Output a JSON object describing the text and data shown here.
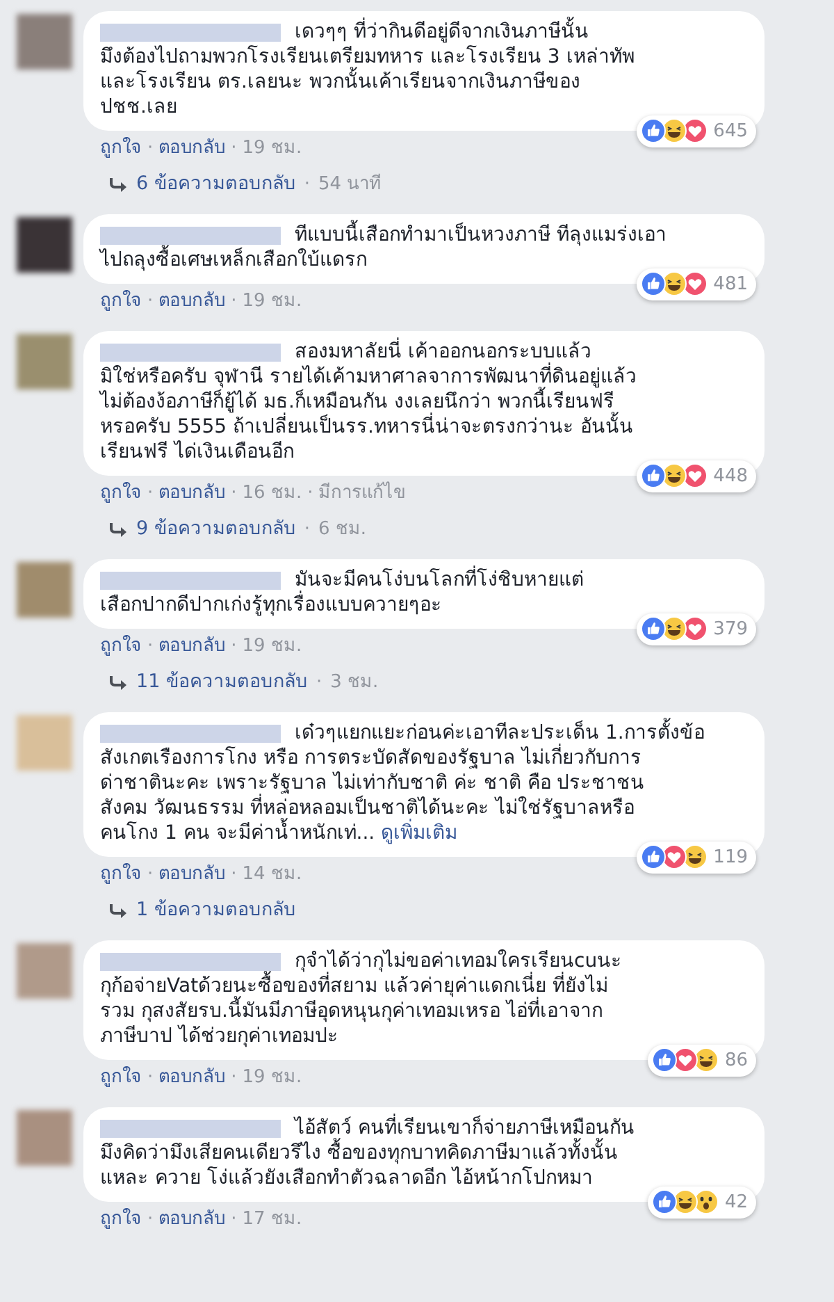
{
  "separator": "·",
  "comments": [
    {
      "lines": [
        "เดวๆๆ ที่ว่ากินดีอยู่ดีจากเงินภาษีนั้น",
        "มึงต้องไปถามพวกโรงเรียนเตรียมทหาร และโรงเรียน 3 เหล่าทัพ",
        "และโรงเรียน ตร.เลยนะ พวกนั้นเค้าเรียนจากเงินภาษีของ",
        "ปชช.เลย"
      ],
      "reactions": [
        {
          "kind": "like"
        },
        {
          "kind": "haha"
        },
        {
          "kind": "love"
        }
      ],
      "count": "645",
      "meta": [
        "ถูกใจ",
        "ตอบกลับ",
        "19 ชม."
      ],
      "replies": {
        "label": "6 ข้อความตอบกลับ",
        "time": "54 นาที"
      }
    },
    {
      "lines": [
        "ทีแบบนี้เสือกทำมาเป็นหวงภาษี ทีลุงแมร่งเอา",
        "ไปถลุงซื้อเศษเหล็กเสือกใบ้แดรก"
      ],
      "reactions": [
        {
          "kind": "like"
        },
        {
          "kind": "haha"
        },
        {
          "kind": "love"
        }
      ],
      "count": "481",
      "meta": [
        "ถูกใจ",
        "ตอบกลับ",
        "19 ชม."
      ]
    },
    {
      "lines": [
        "สองมหาลัยนี่ เค้าออกนอกระบบแล้ว",
        "มิใช่หรือครับ จุฬานี รายได้เค้ามหาศาลจาการพัฒนาที่ดินอยู่แล้ว",
        "ไม่ต้องง้อภาษีก็ยู้ได้ มธ.ก็เหมือนกัน งงเลยนึกว่า พวกนี้เรียนฟรี",
        "หรอครับ 5555 ถ้าเปลี่ยนเป็นรร.ทหารนี่น่าจะตรงกว่านะ อันนั้น",
        "เรียนฟรี ได่เงินเดือนอีก"
      ],
      "reactions": [
        {
          "kind": "like"
        },
        {
          "kind": "haha"
        },
        {
          "kind": "love"
        }
      ],
      "count": "448",
      "meta": [
        "ถูกใจ",
        "ตอบกลับ",
        "16 ชม.",
        "มีการแก้ไข"
      ],
      "replies": {
        "label": "9 ข้อความตอบกลับ",
        "time": "6 ชม."
      }
    },
    {
      "lines": [
        "มันจะมีคนโง่บนโลกที่โง่ชิบหายแต่",
        "เสือกปากดีปากเก่งรู้ทุกเรื่องแบบควายๆอะ"
      ],
      "reactions": [
        {
          "kind": "like"
        },
        {
          "kind": "haha"
        },
        {
          "kind": "love"
        }
      ],
      "count": "379",
      "meta": [
        "ถูกใจ",
        "ตอบกลับ",
        "19 ชม."
      ],
      "replies": {
        "label": "11 ข้อความตอบกลับ",
        "time": "3 ชม."
      }
    },
    {
      "lines": [
        "เด๋วๆแยกแยะก่อนค่ะเอาทีละประเด็น 1.การตั้งข้อ",
        "สังเกตเรืองการโกง หรือ การตระบัดสัดของรัฐบาล ไม่เกี่ยวกับการ",
        "ด่าชาตินะคะ เพราะรัฐบาล ไม่เท่ากับชาติ ค่ะ ชาติ คือ ประชาชน",
        "สังคม วัฒนธรรม ที่หล่อหลอมเป็นชาติได้นะคะ ไม่ใช่รัฐบาลหรือ",
        "คนโกง 1 คน จะมีค่าน้ำหนักเท่..."
      ],
      "see_more": "ดูเพิ่มเติม",
      "reactions": [
        {
          "kind": "like"
        },
        {
          "kind": "love"
        },
        {
          "kind": "haha"
        }
      ],
      "count": "119",
      "meta": [
        "ถูกใจ",
        "ตอบกลับ",
        "14 ชม."
      ],
      "replies": {
        "label": "1 ข้อความตอบกลับ"
      }
    },
    {
      "lines": [
        "กุจำได้ว่ากุไม่ขอค่าเทอมใครเรียนcuนะ",
        "กุก้อจ่ายVatด้วยนะซื้อของที่สยาม แล้วค่ายุค่าแดกเนี่ย ที่ยังไม่",
        "รวม กุสงสัยรบ.นี้มันมีภาษีอุดหนุนกุค่าเทอมเหรอ ไอ่ที่เอาจาก",
        "ภาษีบาป ได้ช่วยกุค่าเทอมปะ"
      ],
      "reactions": [
        {
          "kind": "like"
        },
        {
          "kind": "love"
        },
        {
          "kind": "haha"
        }
      ],
      "count": "86",
      "meta": [
        "ถูกใจ",
        "ตอบกลับ",
        "19 ชม."
      ]
    },
    {
      "lines": [
        "ไอ้สัตว์ คนที่เรียนเขาก็จ่ายภาษีเหมือนกัน",
        "มึงคิดว่ามึงเสียคนเดียวรึไง ซื้อของทุกบาทคิดภาษีมาแล้วทั้งนั้น",
        "แหละ ควาย โง่แล้วยังเสือกทำตัวฉลาดอีก ไอ้หน้ากโปกหมา"
      ],
      "reactions": [
        {
          "kind": "like"
        },
        {
          "kind": "haha"
        },
        {
          "kind": "wow"
        }
      ],
      "count": "42",
      "meta": [
        "ถูกใจ",
        "ตอบกลับ",
        "17 ชม."
      ]
    }
  ]
}
